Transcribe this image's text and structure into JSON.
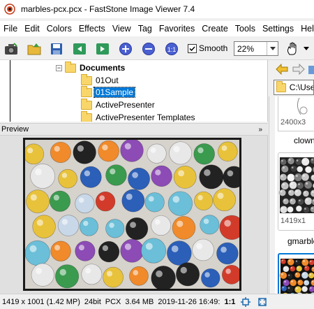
{
  "window": {
    "title": "marbles-pcx.pcx  -  FastStone Image Viewer 7.4"
  },
  "menu": [
    "File",
    "Edit",
    "Colors",
    "Effects",
    "View",
    "Tag",
    "Favorites",
    "Create",
    "Tools",
    "Settings",
    "Help"
  ],
  "toolbar": {
    "buttons": [
      "camera-icon",
      "open-folder-icon",
      "save-icon",
      "previous-icon",
      "next-icon",
      "zoom-in-icon",
      "zoom-out-icon",
      "actual-size-icon"
    ],
    "smooth_label": "Smooth",
    "smooth_checked": true,
    "zoom_value": "22%",
    "pan_icon": "hand-icon"
  },
  "tree": {
    "root_label": "Documents",
    "items": [
      "01Out",
      "01Sample",
      "ActivePresenter",
      "ActivePresenter Templates"
    ],
    "selected": "01Sample"
  },
  "preview": {
    "header": "Preview"
  },
  "browser": {
    "path": "C:\\User",
    "thumbnails": [
      {
        "dim": "2400x3",
        "name": "clowns"
      },
      {
        "dim": "1419x1",
        "name": "gmarble"
      }
    ]
  },
  "status": {
    "dimensions": "1419 x 1001 (1.42 MP)",
    "depth": "24bit",
    "format": "PCX",
    "size": "3.64 MB",
    "date": "2019-11-26 16:49:",
    "ratio": "1:1"
  },
  "colors": {
    "selection": "#0078d7",
    "folder": "#f9d66a",
    "marbles": [
      "#d23b2a",
      "#2b5fb8",
      "#e8c23a",
      "#3a9a4e",
      "#8c4bb5",
      "#e8e8e8",
      "#222222",
      "#f08a2a",
      "#c8d8e8",
      "#6bbfd8"
    ]
  }
}
